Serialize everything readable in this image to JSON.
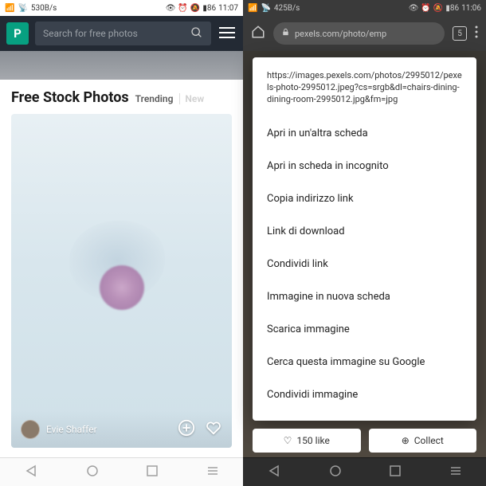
{
  "left": {
    "status": {
      "speed": "530B/s",
      "battery": "86",
      "time": "11:07"
    },
    "search_placeholder": "Search for free photos",
    "title": "Free Stock Photos",
    "tabs": [
      "Trending",
      "New"
    ],
    "author": "Evie Shaffer"
  },
  "right": {
    "status": {
      "speed": "425B/s",
      "battery": "86",
      "time": "11:06"
    },
    "url_display": "pexels.com/photo/emp",
    "tab_count": "5",
    "context_url": "https://images.pexels.com/photos/2995012/pexels-photo-2995012.jpeg?cs=srgb&dl=chairs-dining-dining-room-2995012.jpg&fm=jpg",
    "menu_items": [
      "Apri in un'altra scheda",
      "Apri in scheda in incognito",
      "Copia indirizzo link",
      "Link di download",
      "Condividi link",
      "Immagine in nuova scheda",
      "Scarica immagine",
      "Cerca questa immagine su Google",
      "Condividi immagine"
    ],
    "like_label": "150 like",
    "collect_label": "Collect"
  }
}
